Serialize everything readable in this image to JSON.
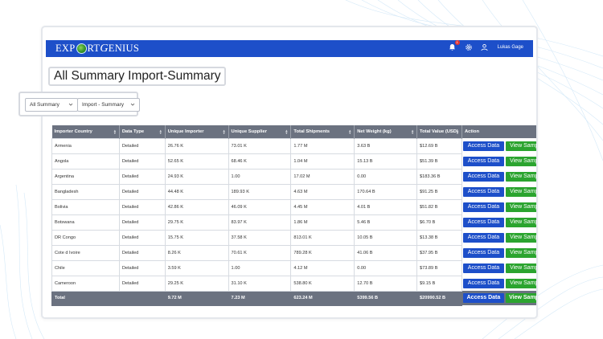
{
  "header": {
    "logo_text_a": "EXP",
    "logo_text_b": "RT",
    "logo_text_c": "G",
    "logo_text_d": "ENIUS",
    "user_name": "Lukas Gage",
    "notification_count": "1"
  },
  "page": {
    "title": "All Summary Import-Summary"
  },
  "filters": {
    "summary_select": "All Summary",
    "type_select": "Import - Summary"
  },
  "table": {
    "columns": [
      "Importer Country",
      "Data Type",
      "Unique Importer",
      "Unique Supplier",
      "Total Shipments",
      "Net Weight (kg)",
      "Total Value (USD)",
      "Action"
    ],
    "rows": [
      [
        "Armenia",
        "Detailed",
        "26.76 K",
        "73.01 K",
        "1.77 M",
        "3.63 B",
        "$12.69 B"
      ],
      [
        "Angola",
        "Detailed",
        "52.65 K",
        "68.46 K",
        "1.04 M",
        "15.13 B",
        "$51.39 B"
      ],
      [
        "Argentina",
        "Detailed",
        "24.93 K",
        "1.00",
        "17.02 M",
        "0.00",
        "$183.36 B"
      ],
      [
        "Bangladesh",
        "Detailed",
        "44.48 K",
        "189.93 K",
        "4.63 M",
        "170.64 B",
        "$91.25 B"
      ],
      [
        "Bolivia",
        "Detailed",
        "42.86 K",
        "46.09 K",
        "4.45 M",
        "4.01 B",
        "$51.82 B"
      ],
      [
        "Botswana",
        "Detailed",
        "29.75 K",
        "83.97 K",
        "1.86 M",
        "5.46 B",
        "$6.70 B"
      ],
      [
        "DR Congo",
        "Detailed",
        "15.75 K",
        "37.58 K",
        "813.01 K",
        "10.05 B",
        "$13.38 B"
      ],
      [
        "Cote d Ivoire",
        "Detailed",
        "8.26 K",
        "70.61 K",
        "789.28 K",
        "41.06 B",
        "$37.95 B"
      ],
      [
        "Chile",
        "Detailed",
        "3.59 K",
        "1.00",
        "4.12 M",
        "0.00",
        "$73.89 B"
      ],
      [
        "Cameroon",
        "Detailed",
        "29.25 K",
        "31.10 K",
        "538.80 K",
        "12.70 B",
        "$9.15 B"
      ]
    ],
    "total": [
      "Total",
      "",
      "9.72 M",
      "7.23 M",
      "623.24 M",
      "5399.56 B",
      "$20990.52 B"
    ],
    "access_label": "Access Data",
    "view_label": "View Sample"
  },
  "colors": {
    "nav": "#1d4fc9",
    "access": "#1d4fc9",
    "view": "#2ba42f",
    "header": "#6b7280"
  }
}
